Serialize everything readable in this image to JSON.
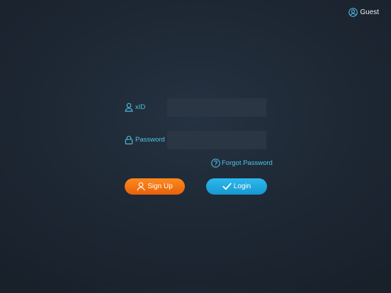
{
  "header": {
    "guest_label": "Guest",
    "guest_icon": "user-circle-icon"
  },
  "form": {
    "xid_label": "xID",
    "xid_icon": "user-outline-icon",
    "xid_value": "",
    "password_label": "Password",
    "password_icon": "lock-icon",
    "password_value": "",
    "forgot_label": "Forgot Password",
    "forgot_icon": "question-circle-icon"
  },
  "actions": {
    "signup_label": "Sign Up",
    "signup_icon": "user-icon",
    "login_label": "Login",
    "login_icon": "checkmark-icon"
  },
  "colors": {
    "accent": "#4fc4e8",
    "signup": "#f07318",
    "login": "#1fa8dd",
    "background": "#1d2733"
  }
}
